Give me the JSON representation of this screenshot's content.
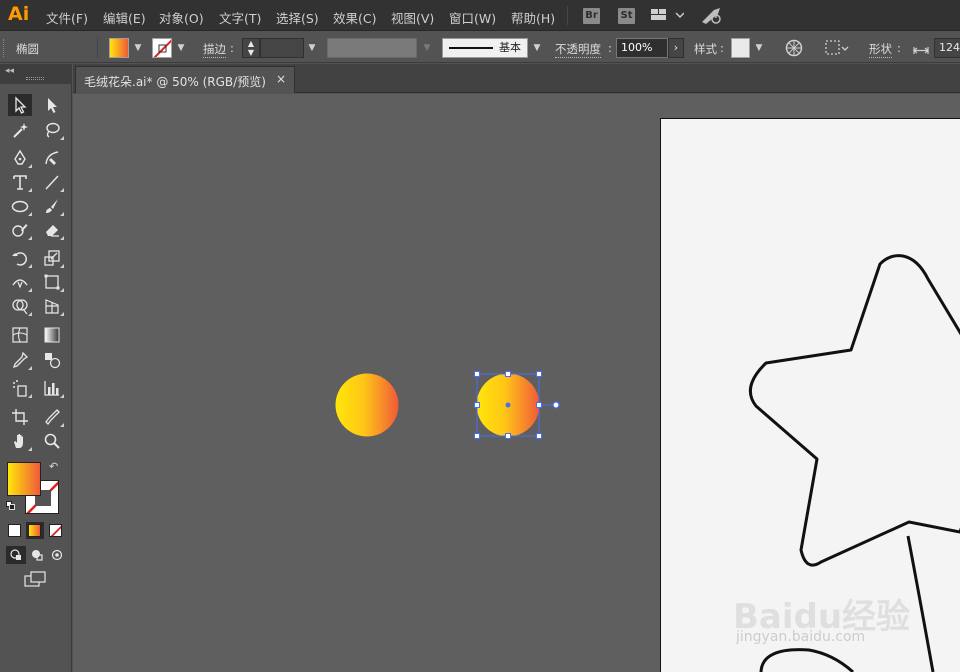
{
  "app": {
    "logo": "Ai"
  },
  "menu": [
    {
      "id": "file",
      "label": "文件(F)"
    },
    {
      "id": "edit",
      "label": "编辑(E)"
    },
    {
      "id": "object",
      "label": "对象(O)"
    },
    {
      "id": "type",
      "label": "文字(T)"
    },
    {
      "id": "select",
      "label": "选择(S)"
    },
    {
      "id": "effect",
      "label": "效果(C)"
    },
    {
      "id": "view",
      "label": "视图(V)"
    },
    {
      "id": "window",
      "label": "窗口(W)"
    },
    {
      "id": "help",
      "label": "帮助(H)"
    }
  ],
  "menubar_extras": {
    "bridge": "Br",
    "stock": "St"
  },
  "control": {
    "object_type": "椭圆",
    "stroke_label": "描边",
    "stroke_profile": "基本",
    "opacity_label": "不透明度",
    "opacity_value": "100%",
    "style_label": "样式",
    "shape_label": "形状",
    "width_value": "124."
  },
  "document": {
    "tab_title": "毛绒花朵.ai* @ 50% (RGB/预览)",
    "close_glyph": "×"
  },
  "colors": {
    "gradient_start": "#ffe60a",
    "gradient_end": "#f05a38",
    "selection": "#4a6cf0",
    "star_stroke": "#141010",
    "artboard": "#f5f4f4"
  },
  "watermark": {
    "main": "Baidu经验",
    "sub": "jingyan.baidu.com"
  }
}
